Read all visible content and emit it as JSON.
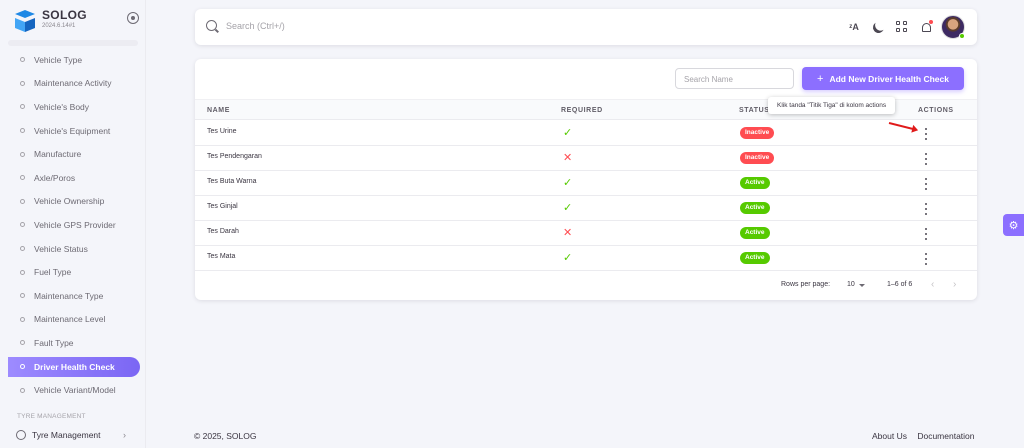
{
  "app": {
    "name": "SOLOG",
    "version": "2024.6.14#1"
  },
  "sidebar": {
    "items": [
      {
        "label": "Vehicle Type"
      },
      {
        "label": "Maintenance Activity"
      },
      {
        "label": "Vehicle's Body"
      },
      {
        "label": "Vehicle's Equipment"
      },
      {
        "label": "Manufacture"
      },
      {
        "label": "Axle/Poros"
      },
      {
        "label": "Vehicle Ownership"
      },
      {
        "label": "Vehicle GPS Provider"
      },
      {
        "label": "Vehicle Status"
      },
      {
        "label": "Fuel Type"
      },
      {
        "label": "Maintenance Type"
      },
      {
        "label": "Maintenance Level"
      },
      {
        "label": "Fault Type"
      },
      {
        "label": "Driver Health Check"
      },
      {
        "label": "Vehicle Variant/Model"
      }
    ],
    "active_index": 13,
    "section_label": "TYRE MANAGEMENT",
    "group_label": "Tyre Management"
  },
  "topbar": {
    "search_placeholder": "Search (Ctrl+/)",
    "icons": [
      "translate-icon",
      "moon-icon",
      "apps-grid-icon",
      "bell-icon"
    ]
  },
  "card": {
    "search_placeholder": "Search Name",
    "add_button_label": "Add New Driver Health Check",
    "columns": [
      "NAME",
      "REQUIRED",
      "STATUS",
      "ACTIONS"
    ],
    "rows": [
      {
        "name": "Tes Urine",
        "required": true,
        "status": "Inactive"
      },
      {
        "name": "Tes Pendengaran",
        "required": false,
        "status": "Inactive"
      },
      {
        "name": "Tes Buta Warna",
        "required": true,
        "status": "Active"
      },
      {
        "name": "Tes Ginjal",
        "required": true,
        "status": "Active"
      },
      {
        "name": "Tes Darah",
        "required": false,
        "status": "Active"
      },
      {
        "name": "Tes Mata",
        "required": true,
        "status": "Active"
      }
    ],
    "tooltip": "Klik tanda \"Titik Tiga\" di kolom actions",
    "pagination": {
      "rows_per_page_label": "Rows per page:",
      "rows_per_page": "10",
      "range": "1–6 of 6"
    }
  },
  "colors": {
    "accent": "#8c6fff",
    "active": "#56ca00",
    "inactive": "#ff4c51",
    "annotation_arrow": "#e01a1a"
  },
  "footer": {
    "copyright": "© 2025, SOLOG",
    "links": [
      "About Us",
      "Documentation"
    ]
  }
}
